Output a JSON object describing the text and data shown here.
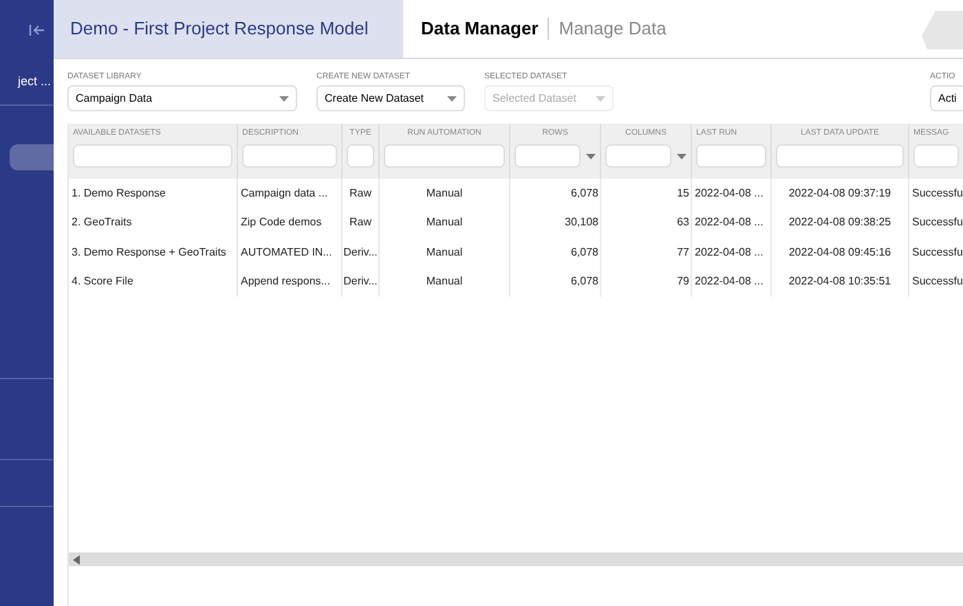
{
  "sidebar": {
    "project_label": "ject ..."
  },
  "header": {
    "project_title": "Demo - First Project Response Model",
    "app_title": "Data Manager",
    "page_title": "Manage Data"
  },
  "toolbar": [
    {
      "label": "DATASET LIBRARY",
      "value": "Campaign Data",
      "disabled": false
    },
    {
      "label": "CREATE NEW DATASET",
      "value": "Create New Dataset",
      "disabled": false
    },
    {
      "label": "SELECTED DATASET",
      "value": "Selected Dataset",
      "disabled": true
    },
    {
      "label": "ACTIO",
      "value": "Acti",
      "disabled": false
    }
  ],
  "table": {
    "columns": [
      {
        "label": "AVAILABLE DATASETS",
        "kind": "text"
      },
      {
        "label": "DESCRIPTION",
        "kind": "text"
      },
      {
        "label": "TYPE",
        "kind": "text"
      },
      {
        "label": "RUN AUTOMATION",
        "kind": "text"
      },
      {
        "label": "ROWS",
        "kind": "dropdown"
      },
      {
        "label": "COLUMNS",
        "kind": "dropdown"
      },
      {
        "label": "LAST RUN",
        "kind": "text"
      },
      {
        "label": "LAST DATA UPDATE",
        "kind": "text"
      },
      {
        "label": "MESSAG",
        "kind": "text"
      }
    ],
    "rows": [
      [
        "1. Demo Response",
        "Campaign data ...",
        "Raw",
        "Manual",
        "6,078",
        "15",
        "2022-04-08 ...",
        "2022-04-08 09:37:19",
        "Successfu"
      ],
      [
        "2. GeoTraits",
        "Zip Code demos",
        "Raw",
        "Manual",
        "30,108",
        "63",
        "2022-04-08 ...",
        "2022-04-08 09:38:25",
        "Successfu"
      ],
      [
        "3. Demo Response + GeoTraits",
        "AUTOMATED IN...",
        "Deriv...",
        "Manual",
        "6,078",
        "77",
        "2022-04-08 ...",
        "2022-04-08 09:45:16",
        "Successfu"
      ],
      [
        "4. Score File",
        "Append respons...",
        "Deriv...",
        "Manual",
        "6,078",
        "79",
        "2022-04-08 ...",
        "2022-04-08 10:35:51",
        "Successfu"
      ]
    ]
  }
}
